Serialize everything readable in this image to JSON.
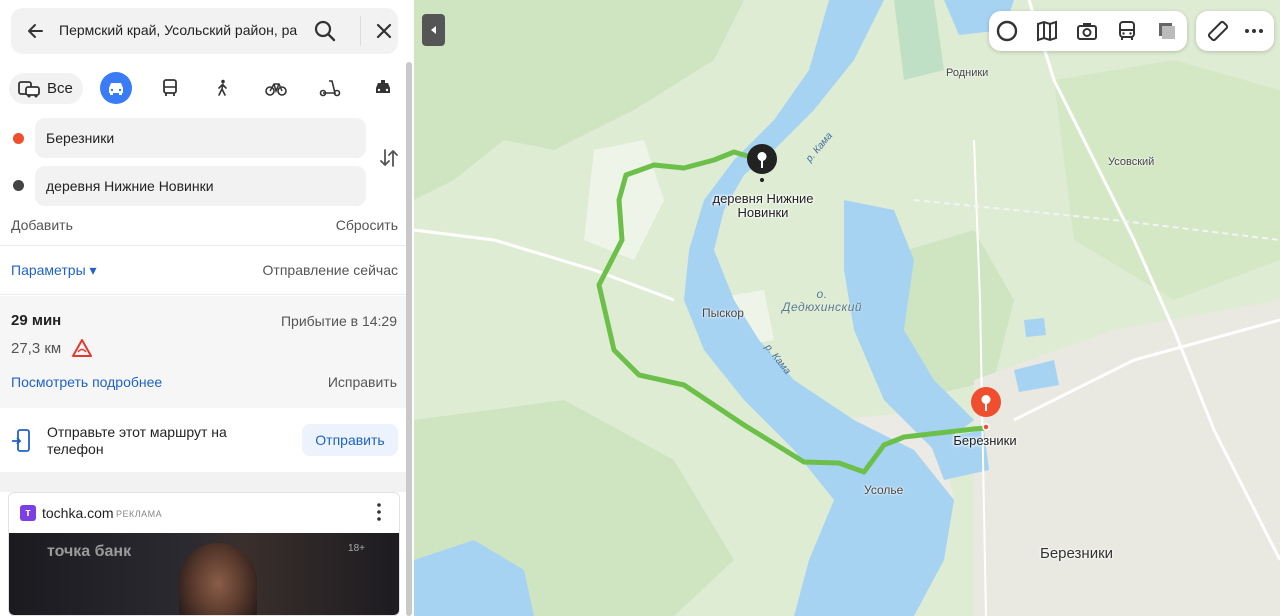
{
  "search": {
    "query": "Пермский край, Усольский район, ра"
  },
  "modes": {
    "all_label": "Все"
  },
  "route": {
    "from": "Березники",
    "to": "деревня Нижние Новинки",
    "add_label": "Добавить",
    "reset_label": "Сбросить",
    "params_label": "Параметры ▾",
    "departure": "Отправление сейчас"
  },
  "summary": {
    "duration": "29 мин",
    "arrival": "Прибытие в 14:29",
    "distance": "27,3 км",
    "details_link": "Посмотреть подробнее",
    "fix_link": "Исправить"
  },
  "share": {
    "text": "Отправьте этот маршрут на телефон",
    "button": "Отправить"
  },
  "ad": {
    "domain": "tochka.com",
    "label": "РЕКЛАМА",
    "logo_letter": "т",
    "banner_text": "точка банк",
    "age": "18+"
  },
  "map": {
    "labels": {
      "rodniki": "Родники",
      "usovsky": "Усовский",
      "pyskor": "Пыскор",
      "usolye": "Усолье",
      "berezniki_big": "Березники"
    },
    "lake": "о.\nДедюхинский",
    "river_top": "р. Кама",
    "river_mid": "р. Кама",
    "pin_dest_label": "деревня Нижние\nНовинки",
    "pin_start_label": "Березники"
  },
  "colors": {
    "accent": "#3a7cf5",
    "route": "#6cc04a",
    "water": "#a7d3f2",
    "land": "#dfecd4",
    "start_pin": "#f04f2f",
    "dest_pin": "#222222"
  }
}
